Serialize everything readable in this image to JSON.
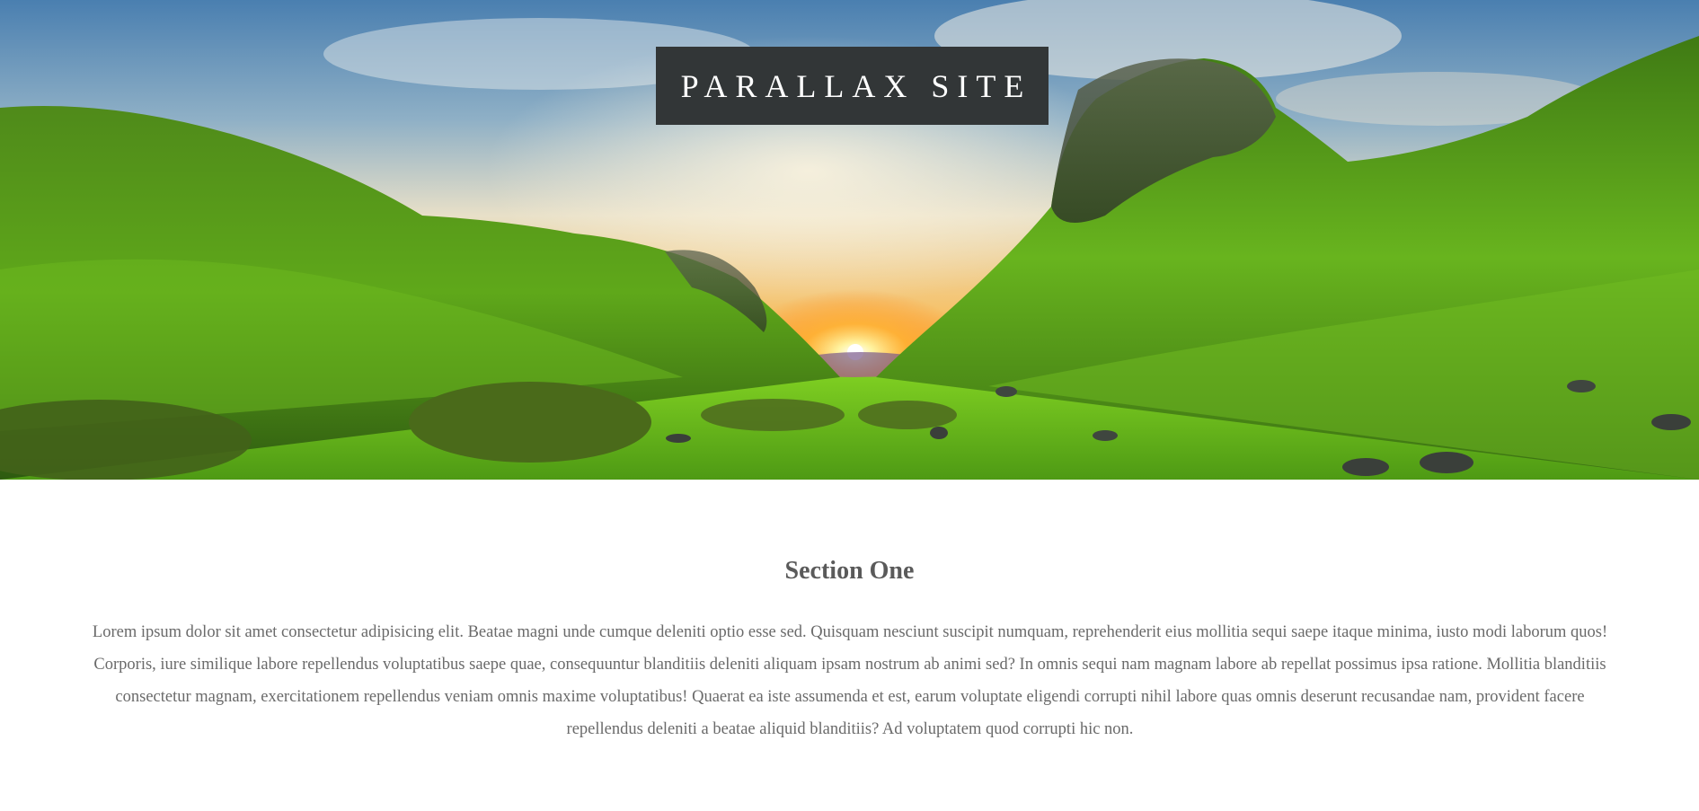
{
  "hero": {
    "title": "PARALLAX SITE",
    "image": "green-valley-sunset-landscape"
  },
  "section_one": {
    "title": "Section One",
    "body": "Lorem ipsum dolor sit amet consectetur adipisicing elit. Beatae magni unde cumque deleniti optio esse sed. Quisquam nesciunt suscipit numquam, reprehenderit eius mollitia sequi saepe itaque minima, iusto modi laborum quos! Corporis, iure similique labore repellendus voluptatibus saepe quae, consequuntur blanditiis deleniti aliquam ipsam nostrum ab animi sed? In omnis sequi nam magnam labore ab repellat possimus ipsa ratione. Mollitia blanditiis consectetur magnam, exercitationem repellendus veniam omnis maxime voluptatibus! Quaerat ea iste assumenda et est, earum voluptate eligendi corrupti nihil labore quas omnis deserunt recusandae nam, provident facere repellendus deleniti a beatae aliquid blanditiis? Ad voluptatem quod corrupti hic non."
  },
  "colors": {
    "title_box": "#323637",
    "section_title": "#5a5a5a",
    "body_text": "#6a6a6a"
  }
}
